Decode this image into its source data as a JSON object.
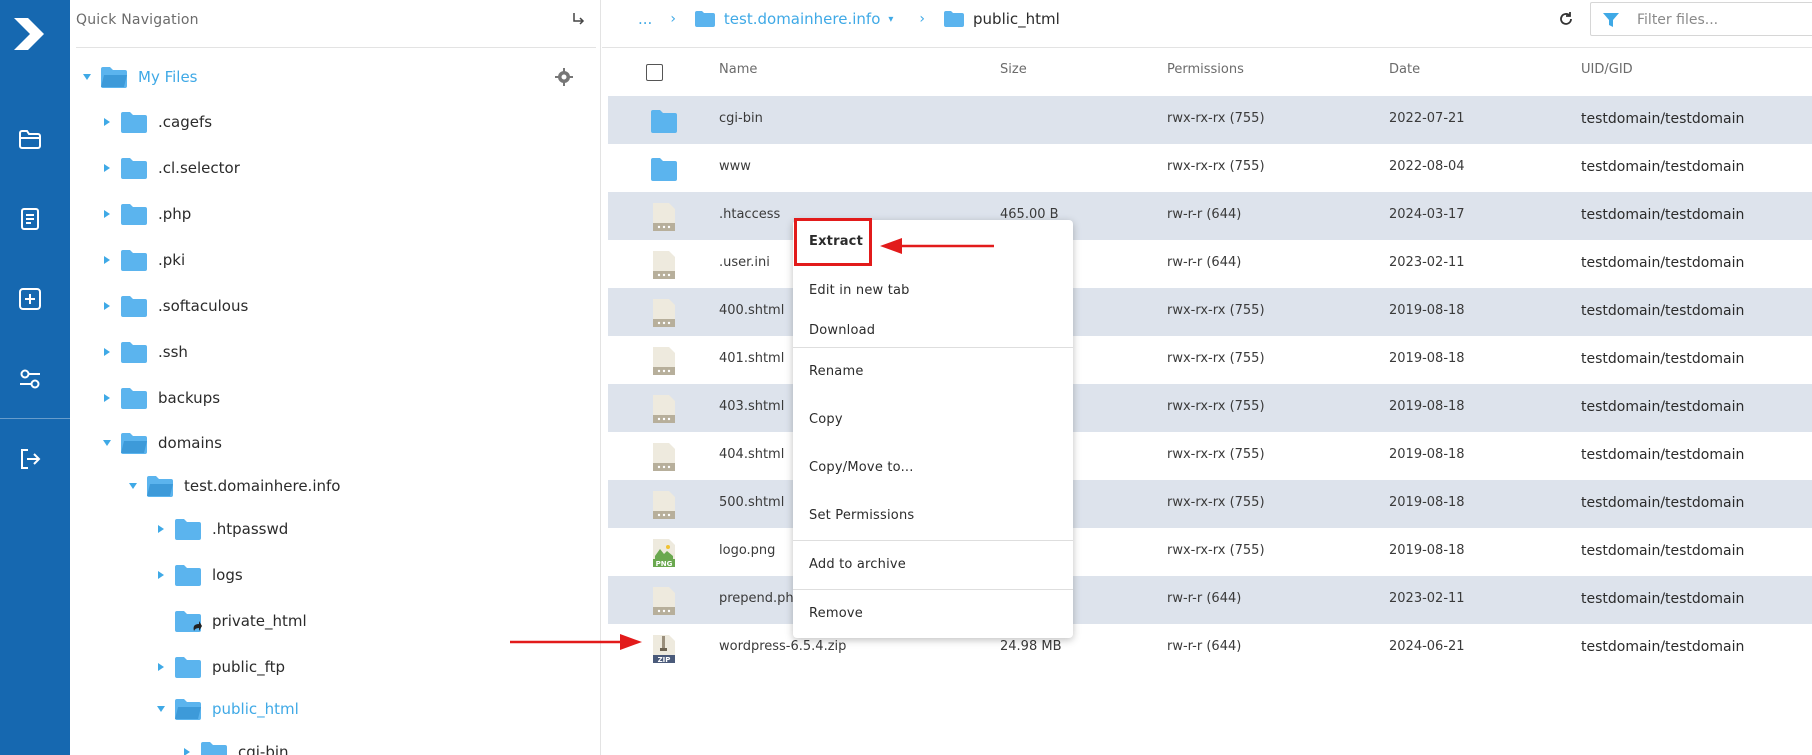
{
  "rail": {
    "icons": [
      "logo-icon",
      "folder-icon",
      "document-icon",
      "add-icon",
      "settings-sliders-icon",
      "logout-icon"
    ]
  },
  "tree": {
    "title": "Quick Navigation",
    "root_label": "My Files",
    "items": [
      {
        "label": ".cagefs"
      },
      {
        "label": ".cl.selector"
      },
      {
        "label": ".php"
      },
      {
        "label": ".pki"
      },
      {
        "label": ".softaculous"
      },
      {
        "label": ".ssh"
      },
      {
        "label": "backups"
      },
      {
        "label": "domains"
      },
      {
        "label": "test.domainhere.info"
      },
      {
        "label": ".htpasswd"
      },
      {
        "label": "logs"
      },
      {
        "label": "private_html"
      },
      {
        "label": "public_ftp"
      },
      {
        "label": "public_html"
      },
      {
        "label": "cgi-bin"
      }
    ]
  },
  "breadcrumb": {
    "ellipsis": "...",
    "domain": "test.domainhere.info",
    "current": "public_html"
  },
  "filter": {
    "placeholder": "Filter files..."
  },
  "columns": {
    "name": "Name",
    "size": "Size",
    "permissions": "Permissions",
    "date": "Date",
    "uid": "UID/GID"
  },
  "files": [
    {
      "name": "cgi-bin",
      "size": "",
      "perm": "rwx-rx-rx (755)",
      "date": "2022-07-21",
      "uid": "testdomain/testdomain",
      "icon": "folder-icon"
    },
    {
      "name": "www",
      "size": "",
      "perm": "rwx-rx-rx (755)",
      "date": "2022-08-04",
      "uid": "testdomain/testdomain",
      "icon": "folder-icon"
    },
    {
      "name": ".htaccess",
      "size": "465.00 B",
      "perm": "rw-r-r (644)",
      "date": "2024-03-17",
      "uid": "testdomain/testdomain",
      "icon": "file-icon"
    },
    {
      "name": ".user.ini",
      "size": "",
      "perm": "rw-r-r (644)",
      "date": "2023-02-11",
      "uid": "testdomain/testdomain",
      "icon": "file-icon"
    },
    {
      "name": "400.shtml",
      "size": "",
      "perm": "rwx-rx-rx (755)",
      "date": "2019-08-18",
      "uid": "testdomain/testdomain",
      "icon": "file-icon"
    },
    {
      "name": "401.shtml",
      "size": "",
      "perm": "rwx-rx-rx (755)",
      "date": "2019-08-18",
      "uid": "testdomain/testdomain",
      "icon": "file-icon"
    },
    {
      "name": "403.shtml",
      "size": "",
      "perm": "rwx-rx-rx (755)",
      "date": "2019-08-18",
      "uid": "testdomain/testdomain",
      "icon": "file-icon"
    },
    {
      "name": "404.shtml",
      "size": "",
      "perm": "rwx-rx-rx (755)",
      "date": "2019-08-18",
      "uid": "testdomain/testdomain",
      "icon": "file-icon"
    },
    {
      "name": "500.shtml",
      "size": "",
      "perm": "rwx-rx-rx (755)",
      "date": "2019-08-18",
      "uid": "testdomain/testdomain",
      "icon": "file-icon"
    },
    {
      "name": "logo.png",
      "size": "",
      "perm": "rwx-rx-rx (755)",
      "date": "2019-08-18",
      "uid": "testdomain/testdomain",
      "icon": "png-icon",
      "badge": "PNG"
    },
    {
      "name": "prepend.ph",
      "size": "",
      "perm": "rw-r-r (644)",
      "date": "2023-02-11",
      "uid": "testdomain/testdomain",
      "icon": "file-icon"
    },
    {
      "name": "wordpress-6.5.4.zip",
      "size": "24.98 MB",
      "perm": "rw-r-r (644)",
      "date": "2024-06-21",
      "uid": "testdomain/testdomain",
      "icon": "zip-icon",
      "badge": "ZIP"
    }
  ],
  "context_menu": {
    "items": [
      "Extract",
      "Edit in new tab",
      "Download",
      "Rename",
      "Copy",
      "Copy/Move to...",
      "Set Permissions",
      "Add to archive",
      "Remove"
    ]
  },
  "colors": {
    "rail": "#1668b0",
    "folder": "#5bb4ee",
    "accent": "#3fa9e6",
    "row_alt": "#dde3ec",
    "annotation": "#e21b1b"
  }
}
